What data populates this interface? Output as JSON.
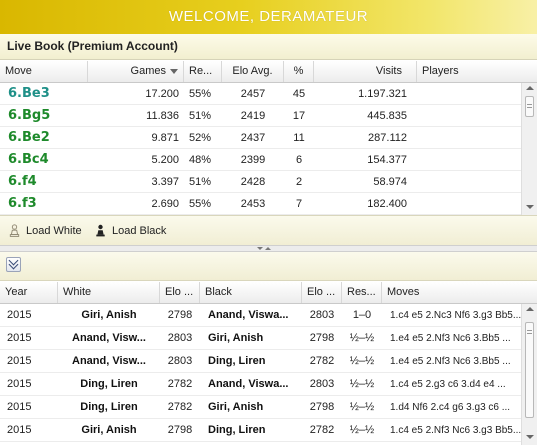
{
  "banner": {
    "text": "WELCOME, DERAMATEUR"
  },
  "book": {
    "title": "Live Book (Premium Account)",
    "columns": [
      "Move",
      "Games",
      "Re...",
      "Elo Avg.",
      "%",
      "Visits",
      "Players"
    ],
    "rows": [
      {
        "move": "6.Be3",
        "games": "17.200",
        "result": "55%",
        "elo": "2457",
        "pct": "45",
        "visits": "1.197.321"
      },
      {
        "move": "6.Bg5",
        "games": "11.836",
        "result": "51%",
        "elo": "2419",
        "pct": "17",
        "visits": "445.835"
      },
      {
        "move": "6.Be2",
        "games": "9.871",
        "result": "52%",
        "elo": "2437",
        "pct": "11",
        "visits": "287.112"
      },
      {
        "move": "6.Bc4",
        "games": "5.200",
        "result": "48%",
        "elo": "2399",
        "pct": "6",
        "visits": "154.377"
      },
      {
        "move": "6.f4",
        "games": "3.397",
        "result": "51%",
        "elo": "2428",
        "pct": "2",
        "visits": "58.974"
      },
      {
        "move": "6.f3",
        "games": "2.690",
        "result": "55%",
        "elo": "2453",
        "pct": "7",
        "visits": "182.400"
      }
    ]
  },
  "load": {
    "white_label": "Load White",
    "black_label": "Load Black"
  },
  "games": {
    "columns": [
      "Year",
      "White",
      "Elo ...",
      "Black",
      "Elo ...",
      "Res...",
      "Moves"
    ],
    "rows": [
      {
        "year": "2015",
        "white": "Giri, Anish",
        "white_elo": "2798",
        "black": "Anand, Viswa...",
        "black_elo": "2803",
        "result": "1–0",
        "moves": "1.c4 e5 2.Nc3 Nf6 3.g3 Bb5..."
      },
      {
        "year": "2015",
        "white": "Anand, Visw...",
        "white_elo": "2803",
        "black": "Giri, Anish",
        "black_elo": "2798",
        "result": "½–½",
        "moves": "1.e4 e5 2.Nf3 Nc6 3.Bb5 ..."
      },
      {
        "year": "2015",
        "white": "Anand, Visw...",
        "white_elo": "2803",
        "black": "Ding, Liren",
        "black_elo": "2782",
        "result": "½–½",
        "moves": "1.e4 e5 2.Nf3 Nc6 3.Bb5 ..."
      },
      {
        "year": "2015",
        "white": "Ding, Liren",
        "white_elo": "2782",
        "black": "Anand, Viswa...",
        "black_elo": "2803",
        "result": "½–½",
        "moves": "1.c4 e5 2.g3 c6 3.d4 e4 ..."
      },
      {
        "year": "2015",
        "white": "Ding, Liren",
        "white_elo": "2782",
        "black": "Giri, Anish",
        "black_elo": "2798",
        "result": "½–½",
        "moves": "1.d4 Nf6 2.c4 g6 3.g3 c6 ..."
      },
      {
        "year": "2015",
        "white": "Giri, Anish",
        "white_elo": "2798",
        "black": "Ding, Liren",
        "black_elo": "2782",
        "result": "½–½",
        "moves": "1.c4 e5 2.Nf3 Nc6 3.g3 Bb5..."
      }
    ]
  },
  "colors": {
    "accent": "#d9b700",
    "move_text": "#1e8a2b",
    "selected_move_text": "#1f9088"
  },
  "icons": {
    "load_white": "white-pawn-icon",
    "load_black": "black-pawn-icon",
    "collapse": "double-chevron-down-icon",
    "sort": "sort-descending-icon"
  }
}
